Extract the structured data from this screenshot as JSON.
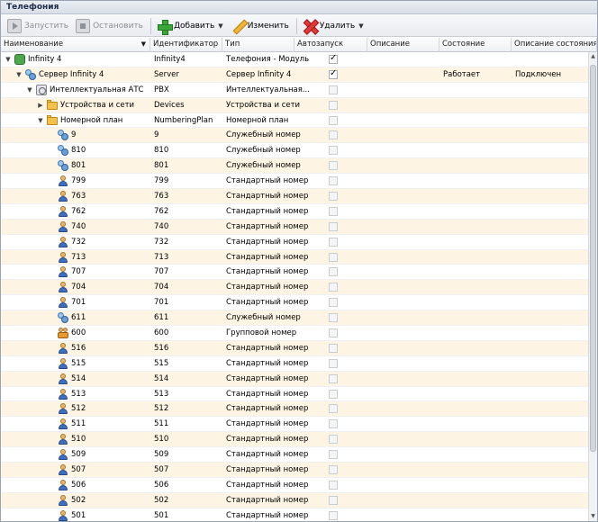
{
  "window": {
    "title": "Телефония"
  },
  "toolbar": {
    "start_label": "Запустить",
    "stop_label": "Остановить",
    "add_label": "Добавить",
    "edit_label": "Изменить",
    "delete_label": "Удалить"
  },
  "columns": [
    "Наименование",
    "Идентификатор",
    "Тип",
    "Автозапуск",
    "Описание",
    "Состояние",
    "Описание состояния"
  ],
  "rows": [
    {
      "name": "Infinity 4",
      "id": "Infinity4",
      "type": "Телефония - Модуль",
      "auto": true,
      "desc": "",
      "state": "",
      "state_desc": "",
      "level": 0,
      "expander": "down",
      "icon": "root-icon"
    },
    {
      "name": "Сервер Infinity 4",
      "id": "Server",
      "type": "Сервер Infinity 4",
      "auto": true,
      "desc": "",
      "state": "Работает",
      "state_desc": "Подключен",
      "level": 1,
      "expander": "down",
      "icon": "server-icon"
    },
    {
      "name": "Интеллектуальная АТС",
      "id": "PBX",
      "type": "Интеллектуальная...",
      "auto": false,
      "desc": "",
      "state": "",
      "state_desc": "",
      "level": 2,
      "expander": "down",
      "icon": "pbx-icon"
    },
    {
      "name": "Устройства и сети",
      "id": "Devices",
      "type": "Устройства и сети",
      "auto": false,
      "desc": "",
      "state": "",
      "state_desc": "",
      "level": 3,
      "expander": "right",
      "icon": "folder-icon"
    },
    {
      "name": "Номерной план",
      "id": "NumberingPlan",
      "type": "Номерной план",
      "auto": false,
      "desc": "",
      "state": "",
      "state_desc": "",
      "level": 3,
      "expander": "down",
      "icon": "folder-icon"
    },
    {
      "name": "9",
      "id": "9",
      "type": "Служебный номер",
      "auto": false,
      "level": 4,
      "icon": "service-icon"
    },
    {
      "name": "810",
      "id": "810",
      "type": "Служебный номер",
      "auto": false,
      "level": 4,
      "icon": "service-icon"
    },
    {
      "name": "801",
      "id": "801",
      "type": "Служебный номер",
      "auto": false,
      "level": 4,
      "icon": "service-icon"
    },
    {
      "name": "799",
      "id": "799",
      "type": "Стандартный номер",
      "auto": false,
      "level": 4,
      "icon": "user-icon"
    },
    {
      "name": "763",
      "id": "763",
      "type": "Стандартный номер",
      "auto": false,
      "level": 4,
      "icon": "user-icon"
    },
    {
      "name": "762",
      "id": "762",
      "type": "Стандартный номер",
      "auto": false,
      "level": 4,
      "icon": "user-icon"
    },
    {
      "name": "740",
      "id": "740",
      "type": "Стандартный номер",
      "auto": false,
      "level": 4,
      "icon": "user-icon"
    },
    {
      "name": "732",
      "id": "732",
      "type": "Стандартный номер",
      "auto": false,
      "level": 4,
      "icon": "user-icon"
    },
    {
      "name": "713",
      "id": "713",
      "type": "Стандартный номер",
      "auto": false,
      "level": 4,
      "icon": "user-icon"
    },
    {
      "name": "707",
      "id": "707",
      "type": "Стандартный номер",
      "auto": false,
      "level": 4,
      "icon": "user-icon"
    },
    {
      "name": "704",
      "id": "704",
      "type": "Стандартный номер",
      "auto": false,
      "level": 4,
      "icon": "user-icon"
    },
    {
      "name": "701",
      "id": "701",
      "type": "Стандартный номер",
      "auto": false,
      "level": 4,
      "icon": "user-icon"
    },
    {
      "name": "611",
      "id": "611",
      "type": "Служебный номер",
      "auto": false,
      "level": 4,
      "icon": "service-icon"
    },
    {
      "name": "600",
      "id": "600",
      "type": "Групповой номер",
      "auto": false,
      "level": 4,
      "icon": "group-icon"
    },
    {
      "name": "516",
      "id": "516",
      "type": "Стандартный номер",
      "auto": false,
      "level": 4,
      "icon": "user-icon"
    },
    {
      "name": "515",
      "id": "515",
      "type": "Стандартный номер",
      "auto": false,
      "level": 4,
      "icon": "user-icon"
    },
    {
      "name": "514",
      "id": "514",
      "type": "Стандартный номер",
      "auto": false,
      "level": 4,
      "icon": "user-icon"
    },
    {
      "name": "513",
      "id": "513",
      "type": "Стандартный номер",
      "auto": false,
      "level": 4,
      "icon": "user-icon"
    },
    {
      "name": "512",
      "id": "512",
      "type": "Стандартный номер",
      "auto": false,
      "level": 4,
      "icon": "user-icon"
    },
    {
      "name": "511",
      "id": "511",
      "type": "Стандартный номер",
      "auto": false,
      "level": 4,
      "icon": "user-icon"
    },
    {
      "name": "510",
      "id": "510",
      "type": "Стандартный номер",
      "auto": false,
      "level": 4,
      "icon": "user-icon"
    },
    {
      "name": "509",
      "id": "509",
      "type": "Стандартный номер",
      "auto": false,
      "level": 4,
      "icon": "user-icon"
    },
    {
      "name": "507",
      "id": "507",
      "type": "Стандартный номер",
      "auto": false,
      "level": 4,
      "icon": "user-icon"
    },
    {
      "name": "506",
      "id": "506",
      "type": "Стандартный номер",
      "auto": false,
      "level": 4,
      "icon": "user-icon"
    },
    {
      "name": "502",
      "id": "502",
      "type": "Стандартный номер",
      "auto": false,
      "level": 4,
      "icon": "user-icon"
    },
    {
      "name": "501",
      "id": "501",
      "type": "Стандартный номер",
      "auto": false,
      "level": 4,
      "icon": "user-icon"
    }
  ]
}
